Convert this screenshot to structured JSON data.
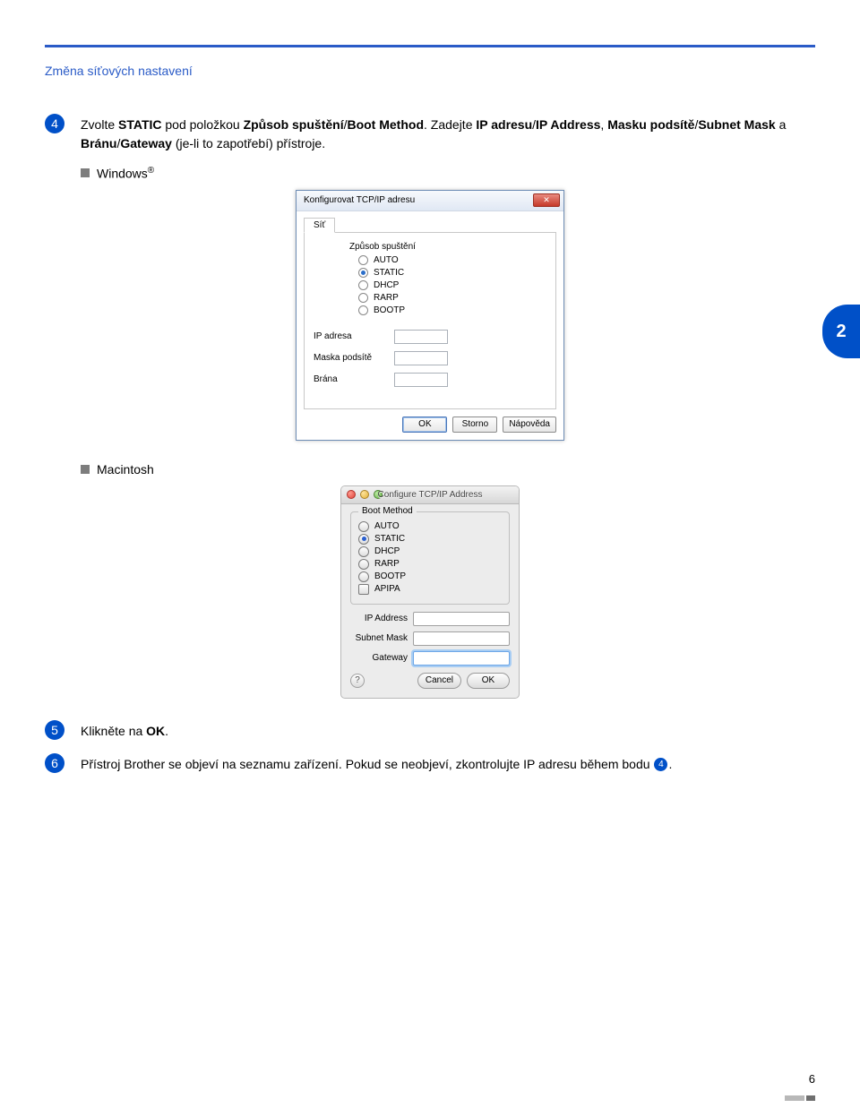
{
  "breadcrumb": "Změna síťových nastavení",
  "side_badge": "2",
  "page_number": "6",
  "steps": {
    "s4": {
      "num": "4",
      "pre": "Zvolte ",
      "bold1": "STATIC",
      "mid": " pod položkou ",
      "bold2": "Způsob spuštění",
      "slash": "/",
      "bold3": "Boot Method",
      "after": ". Zadejte ",
      "bold4": "IP adresu",
      "slash2": "/",
      "bold5": "IP Address",
      "after2": ", ",
      "bold6": "Masku podsítě",
      "slash3": "/",
      "bold7": "Subnet Mask",
      "after3": " a ",
      "bold8": "Bránu",
      "slash4": "/",
      "bold9": "Gateway",
      "after4": " (je-li to zapotřebí) přístroje."
    },
    "s5": {
      "num": "5",
      "pre": "Klikněte na ",
      "bold1": "OK",
      "after": "."
    },
    "s6": {
      "num": "6",
      "text1": "Přístroj Brother se objeví na seznamu zařízení. Pokud se neobjeví, zkontrolujte IP adresu během bodu ",
      "ref": "4",
      "text2": "."
    }
  },
  "bullets": {
    "windows": "Windows",
    "macintosh": "Macintosh"
  },
  "win": {
    "title": "Konfigurovat TCP/IP adresu",
    "tab": "Síť",
    "group": "Způsob spuštění",
    "opts": {
      "auto": "AUTO",
      "static": "STATIC",
      "dhcp": "DHCP",
      "rarp": "RARP",
      "bootp": "BOOTP"
    },
    "fields": {
      "ip": "IP adresa",
      "mask": "Maska podsítě",
      "gw": "Brána"
    },
    "btns": {
      "ok": "OK",
      "cancel": "Storno",
      "help": "Nápověda"
    }
  },
  "mac": {
    "title": "Configure TCP/IP Address",
    "group": "Boot Method",
    "opts": {
      "auto": "AUTO",
      "static": "STATIC",
      "dhcp": "DHCP",
      "rarp": "RARP",
      "bootp": "BOOTP",
      "apipa": "APIPA"
    },
    "fields": {
      "ip": "IP Address",
      "mask": "Subnet Mask",
      "gw": "Gateway"
    },
    "btns": {
      "cancel": "Cancel",
      "ok": "OK",
      "help": "?"
    }
  }
}
